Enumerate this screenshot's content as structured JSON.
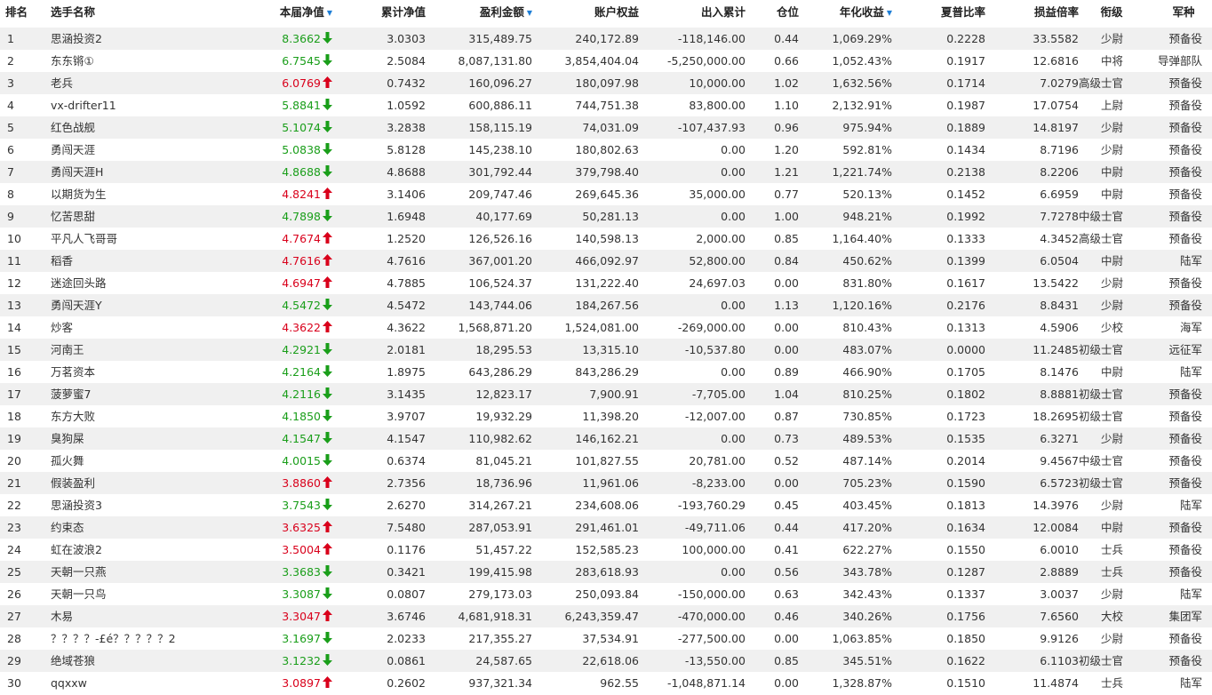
{
  "colors": {
    "up": "#d9001b",
    "down": "#1a9e1a",
    "sort_icon": "#1e7ed6",
    "stripe": "#f0f0f0"
  },
  "columns": {
    "rank": "排名",
    "name": "选手名称",
    "nav": "本届净值",
    "cum_nav": "累计净值",
    "profit": "盈利金额",
    "equity": "账户权益",
    "inout": "出入累计",
    "position": "仓位",
    "annual": "年化收益",
    "sharpe": "夏普比率",
    "pl_ratio": "损益倍率",
    "rank_title": "衔级",
    "branch": "军种"
  },
  "sort_icon": "sort-desc-icon",
  "rows": [
    {
      "rank": "1",
      "name": "思涵投资2",
      "nav": "8.3662",
      "dir": "down",
      "cum_nav": "3.0303",
      "profit": "315,489.75",
      "equity": "240,172.89",
      "inout": "-118,146.00",
      "position": "0.44",
      "annual": "1,069.29%",
      "sharpe": "0.2228",
      "pl_ratio": "33.5582",
      "rank_title": "少尉",
      "branch": "预备役"
    },
    {
      "rank": "2",
      "name": "东东锵①",
      "nav": "6.7545",
      "dir": "down",
      "cum_nav": "2.5084",
      "profit": "8,087,131.80",
      "equity": "3,854,404.04",
      "inout": "-5,250,000.00",
      "position": "0.66",
      "annual": "1,052.43%",
      "sharpe": "0.1917",
      "pl_ratio": "12.6816",
      "rank_title": "中将",
      "branch": "导弹部队"
    },
    {
      "rank": "3",
      "name": "老兵",
      "nav": "6.0769",
      "dir": "up",
      "cum_nav": "0.7432",
      "profit": "160,096.27",
      "equity": "180,097.98",
      "inout": "10,000.00",
      "position": "1.02",
      "annual": "1,632.56%",
      "sharpe": "0.1714",
      "pl_ratio": "7.0279",
      "rank_title": "高级士官",
      "branch": "预备役"
    },
    {
      "rank": "4",
      "name": "vx-drifter11",
      "nav": "5.8841",
      "dir": "down",
      "cum_nav": "1.0592",
      "profit": "600,886.11",
      "equity": "744,751.38",
      "inout": "83,800.00",
      "position": "1.10",
      "annual": "2,132.91%",
      "sharpe": "0.1987",
      "pl_ratio": "17.0754",
      "rank_title": "上尉",
      "branch": "预备役"
    },
    {
      "rank": "5",
      "name": "红色战舰",
      "nav": "5.1074",
      "dir": "down",
      "cum_nav": "3.2838",
      "profit": "158,115.19",
      "equity": "74,031.09",
      "inout": "-107,437.93",
      "position": "0.96",
      "annual": "975.94%",
      "sharpe": "0.1889",
      "pl_ratio": "14.8197",
      "rank_title": "少尉",
      "branch": "预备役"
    },
    {
      "rank": "6",
      "name": "勇闯天涯",
      "nav": "5.0838",
      "dir": "down",
      "cum_nav": "5.8128",
      "profit": "145,238.10",
      "equity": "180,802.63",
      "inout": "0.00",
      "position": "1.20",
      "annual": "592.81%",
      "sharpe": "0.1434",
      "pl_ratio": "8.7196",
      "rank_title": "少尉",
      "branch": "预备役"
    },
    {
      "rank": "7",
      "name": "勇闯天涯H",
      "nav": "4.8688",
      "dir": "down",
      "cum_nav": "4.8688",
      "profit": "301,792.44",
      "equity": "379,798.40",
      "inout": "0.00",
      "position": "1.21",
      "annual": "1,221.74%",
      "sharpe": "0.2138",
      "pl_ratio": "8.2206",
      "rank_title": "中尉",
      "branch": "预备役"
    },
    {
      "rank": "8",
      "name": "以期货为生",
      "nav": "4.8241",
      "dir": "up",
      "cum_nav": "3.1406",
      "profit": "209,747.46",
      "equity": "269,645.36",
      "inout": "35,000.00",
      "position": "0.77",
      "annual": "520.13%",
      "sharpe": "0.1452",
      "pl_ratio": "6.6959",
      "rank_title": "中尉",
      "branch": "预备役"
    },
    {
      "rank": "9",
      "name": "忆苦思甜",
      "nav": "4.7898",
      "dir": "down",
      "cum_nav": "1.6948",
      "profit": "40,177.69",
      "equity": "50,281.13",
      "inout": "0.00",
      "position": "1.00",
      "annual": "948.21%",
      "sharpe": "0.1992",
      "pl_ratio": "7.7278",
      "rank_title": "中级士官",
      "branch": "预备役"
    },
    {
      "rank": "10",
      "name": "平凡人飞哥哥",
      "nav": "4.7674",
      "dir": "up",
      "cum_nav": "1.2520",
      "profit": "126,526.16",
      "equity": "140,598.13",
      "inout": "2,000.00",
      "position": "0.85",
      "annual": "1,164.40%",
      "sharpe": "0.1333",
      "pl_ratio": "4.3452",
      "rank_title": "高级士官",
      "branch": "预备役"
    },
    {
      "rank": "11",
      "name": "稻香",
      "nav": "4.7616",
      "dir": "up",
      "cum_nav": "4.7616",
      "profit": "367,001.20",
      "equity": "466,092.97",
      "inout": "52,800.00",
      "position": "0.84",
      "annual": "450.62%",
      "sharpe": "0.1399",
      "pl_ratio": "6.0504",
      "rank_title": "中尉",
      "branch": "陆军"
    },
    {
      "rank": "12",
      "name": "迷途回头路",
      "nav": "4.6947",
      "dir": "up",
      "cum_nav": "4.7885",
      "profit": "106,524.37",
      "equity": "131,222.40",
      "inout": "24,697.03",
      "position": "0.00",
      "annual": "831.80%",
      "sharpe": "0.1617",
      "pl_ratio": "13.5422",
      "rank_title": "少尉",
      "branch": "预备役"
    },
    {
      "rank": "13",
      "name": "勇闯天涯Y",
      "nav": "4.5472",
      "dir": "down",
      "cum_nav": "4.5472",
      "profit": "143,744.06",
      "equity": "184,267.56",
      "inout": "0.00",
      "position": "1.13",
      "annual": "1,120.16%",
      "sharpe": "0.2176",
      "pl_ratio": "8.8431",
      "rank_title": "少尉",
      "branch": "预备役"
    },
    {
      "rank": "14",
      "name": "炒客",
      "nav": "4.3622",
      "dir": "up",
      "cum_nav": "4.3622",
      "profit": "1,568,871.20",
      "equity": "1,524,081.00",
      "inout": "-269,000.00",
      "position": "0.00",
      "annual": "810.43%",
      "sharpe": "0.1313",
      "pl_ratio": "4.5906",
      "rank_title": "少校",
      "branch": "海军"
    },
    {
      "rank": "15",
      "name": "河南王",
      "nav": "4.2921",
      "dir": "down",
      "cum_nav": "2.0181",
      "profit": "18,295.53",
      "equity": "13,315.10",
      "inout": "-10,537.80",
      "position": "0.00",
      "annual": "483.07%",
      "sharpe": "0.0000",
      "pl_ratio": "11.2485",
      "rank_title": "初级士官",
      "branch": "远征军"
    },
    {
      "rank": "16",
      "name": "万茗资本",
      "nav": "4.2164",
      "dir": "down",
      "cum_nav": "1.8975",
      "profit": "643,286.29",
      "equity": "843,286.29",
      "inout": "0.00",
      "position": "0.89",
      "annual": "466.90%",
      "sharpe": "0.1705",
      "pl_ratio": "8.1476",
      "rank_title": "中尉",
      "branch": "陆军"
    },
    {
      "rank": "17",
      "name": "菠萝蜜7",
      "nav": "4.2116",
      "dir": "down",
      "cum_nav": "3.1435",
      "profit": "12,823.17",
      "equity": "7,900.91",
      "inout": "-7,705.00",
      "position": "1.04",
      "annual": "810.25%",
      "sharpe": "0.1802",
      "pl_ratio": "8.8881",
      "rank_title": "初级士官",
      "branch": "预备役"
    },
    {
      "rank": "18",
      "name": "东方大败",
      "nav": "4.1850",
      "dir": "down",
      "cum_nav": "3.9707",
      "profit": "19,932.29",
      "equity": "11,398.20",
      "inout": "-12,007.00",
      "position": "0.87",
      "annual": "730.85%",
      "sharpe": "0.1723",
      "pl_ratio": "18.2695",
      "rank_title": "初级士官",
      "branch": "预备役"
    },
    {
      "rank": "19",
      "name": "臭狗屎",
      "nav": "4.1547",
      "dir": "down",
      "cum_nav": "4.1547",
      "profit": "110,982.62",
      "equity": "146,162.21",
      "inout": "0.00",
      "position": "0.73",
      "annual": "489.53%",
      "sharpe": "0.1535",
      "pl_ratio": "6.3271",
      "rank_title": "少尉",
      "branch": "预备役"
    },
    {
      "rank": "20",
      "name": "孤火舞",
      "nav": "4.0015",
      "dir": "down",
      "cum_nav": "0.6374",
      "profit": "81,045.21",
      "equity": "101,827.55",
      "inout": "20,781.00",
      "position": "0.52",
      "annual": "487.14%",
      "sharpe": "0.2014",
      "pl_ratio": "9.4567",
      "rank_title": "中级士官",
      "branch": "预备役"
    },
    {
      "rank": "21",
      "name": "假装盈利",
      "nav": "3.8860",
      "dir": "up",
      "cum_nav": "2.7356",
      "profit": "18,736.96",
      "equity": "11,961.06",
      "inout": "-8,233.00",
      "position": "0.00",
      "annual": "705.23%",
      "sharpe": "0.1590",
      "pl_ratio": "6.5723",
      "rank_title": "初级士官",
      "branch": "预备役"
    },
    {
      "rank": "22",
      "name": "思涵投资3",
      "nav": "3.7543",
      "dir": "down",
      "cum_nav": "2.6270",
      "profit": "314,267.21",
      "equity": "234,608.06",
      "inout": "-193,760.29",
      "position": "0.45",
      "annual": "403.45%",
      "sharpe": "0.1813",
      "pl_ratio": "14.3976",
      "rank_title": "少尉",
      "branch": "陆军"
    },
    {
      "rank": "23",
      "name": "约束态",
      "nav": "3.6325",
      "dir": "up",
      "cum_nav": "7.5480",
      "profit": "287,053.91",
      "equity": "291,461.01",
      "inout": "-49,711.06",
      "position": "0.44",
      "annual": "417.20%",
      "sharpe": "0.1634",
      "pl_ratio": "12.0084",
      "rank_title": "中尉",
      "branch": "预备役"
    },
    {
      "rank": "24",
      "name": "虹在波浪2",
      "nav": "3.5004",
      "dir": "up",
      "cum_nav": "0.1176",
      "profit": "51,457.22",
      "equity": "152,585.23",
      "inout": "100,000.00",
      "position": "0.41",
      "annual": "622.27%",
      "sharpe": "0.1550",
      "pl_ratio": "6.0010",
      "rank_title": "士兵",
      "branch": "预备役"
    },
    {
      "rank": "25",
      "name": "天朝一只燕",
      "nav": "3.3683",
      "dir": "down",
      "cum_nav": "0.3421",
      "profit": "199,415.98",
      "equity": "283,618.93",
      "inout": "0.00",
      "position": "0.56",
      "annual": "343.78%",
      "sharpe": "0.1287",
      "pl_ratio": "2.8889",
      "rank_title": "士兵",
      "branch": "预备役"
    },
    {
      "rank": "26",
      "name": "天朝一只鸟",
      "nav": "3.3087",
      "dir": "down",
      "cum_nav": "0.0807",
      "profit": "279,173.03",
      "equity": "250,093.84",
      "inout": "-150,000.00",
      "position": "0.63",
      "annual": "342.43%",
      "sharpe": "0.1337",
      "pl_ratio": "3.0037",
      "rank_title": "少尉",
      "branch": "陆军"
    },
    {
      "rank": "27",
      "name": "木易",
      "nav": "3.3047",
      "dir": "up",
      "cum_nav": "3.6746",
      "profit": "4,681,918.31",
      "equity": "6,243,359.47",
      "inout": "-470,000.00",
      "position": "0.46",
      "annual": "340.26%",
      "sharpe": "0.1756",
      "pl_ratio": "7.6560",
      "rank_title": "大校",
      "branch": "集团军"
    },
    {
      "rank": "28",
      "name": "？？？？-£é？？？？？2",
      "nav": "3.1697",
      "dir": "down",
      "cum_nav": "2.0233",
      "profit": "217,355.27",
      "equity": "37,534.91",
      "inout": "-277,500.00",
      "position": "0.00",
      "annual": "1,063.85%",
      "sharpe": "0.1850",
      "pl_ratio": "9.9126",
      "rank_title": "少尉",
      "branch": "预备役"
    },
    {
      "rank": "29",
      "name": "绝域苍狼",
      "nav": "3.1232",
      "dir": "down",
      "cum_nav": "0.0861",
      "profit": "24,587.65",
      "equity": "22,618.06",
      "inout": "-13,550.00",
      "position": "0.85",
      "annual": "345.51%",
      "sharpe": "0.1622",
      "pl_ratio": "6.1103",
      "rank_title": "初级士官",
      "branch": "预备役"
    },
    {
      "rank": "30",
      "name": "qqxxw",
      "nav": "3.0897",
      "dir": "up",
      "cum_nav": "0.2602",
      "profit": "937,321.34",
      "equity": "962.55",
      "inout": "-1,048,871.14",
      "position": "0.00",
      "annual": "1,328.87%",
      "sharpe": "0.1510",
      "pl_ratio": "11.4874",
      "rank_title": "士兵",
      "branch": "陆军"
    }
  ]
}
